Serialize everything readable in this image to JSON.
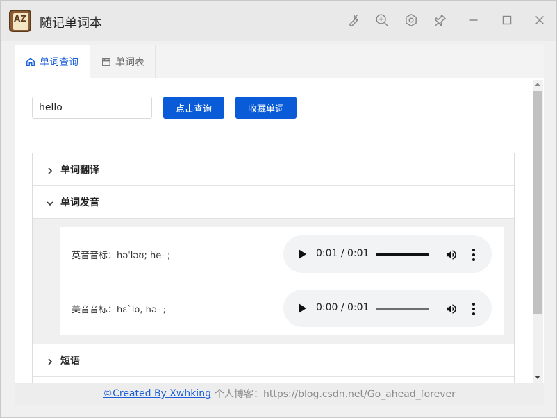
{
  "window": {
    "title": "随记单词本",
    "app_icon_letters": "AZ",
    "toolbar_icons": [
      "wrench-icon",
      "zoom-in-icon",
      "hexagon-settings-icon",
      "pin-icon"
    ],
    "controls": [
      "minimize-icon",
      "maximize-icon",
      "close-icon"
    ]
  },
  "tabs": [
    {
      "label": "单词查询",
      "icon": "home-icon",
      "active": true
    },
    {
      "label": "单词表",
      "icon": "calendar-icon",
      "active": false
    }
  ],
  "search": {
    "value": "hello",
    "query_button": "点击查询",
    "collect_button": "收藏单词"
  },
  "sections": [
    {
      "title": "单词翻译",
      "expanded": false
    },
    {
      "title": "单词发音",
      "expanded": true
    },
    {
      "title": "短语",
      "expanded": false
    }
  ],
  "pronunciation": [
    {
      "label": "英音音标：həˈləʊ; he- ;",
      "time": "0:01 / 0:01"
    },
    {
      "label": "美音音标：hɛˋlo, hə- ;",
      "time": "0:00 / 0:01"
    }
  ],
  "footer": {
    "link_text": "©Created By Xwhking",
    "blog_text": "个人博客：https://blog.csdn.net/Go_ahead_forever"
  },
  "colors": {
    "accent": "#0a5bd8",
    "title_bar": "#e9e9e9"
  }
}
